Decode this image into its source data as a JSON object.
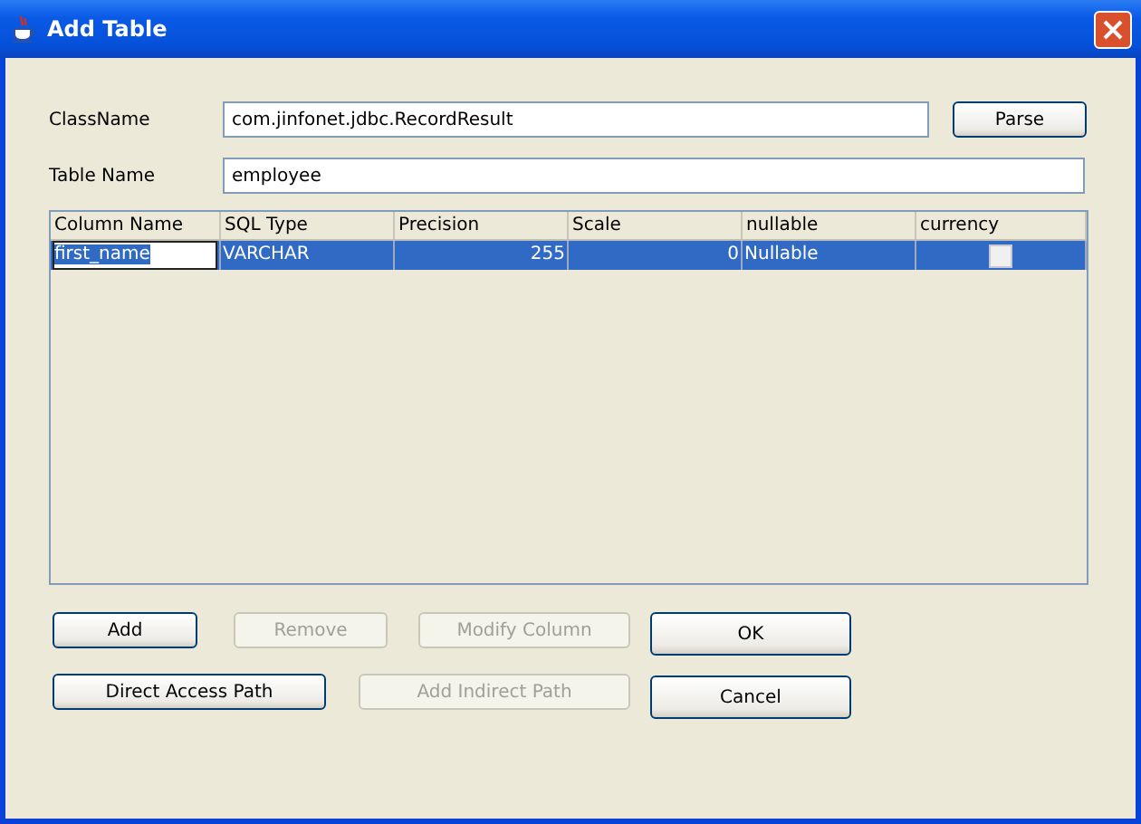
{
  "window": {
    "title": "Add Table"
  },
  "fields": [
    {
      "label": "ClassName",
      "value": "com.jinfonet.jdbc.RecordResult",
      "button": {
        "label": "Parse",
        "disabled": false
      }
    },
    {
      "label": "Table Name",
      "value": "employee"
    }
  ],
  "table": {
    "columns": [
      "Column Name",
      "SQL Type",
      "Precision",
      "Scale",
      "nullable",
      "currency"
    ],
    "rows": [
      {
        "selected": true,
        "cells": [
          {
            "kind": "text",
            "text": "first_name",
            "editing": true
          },
          {
            "kind": "text",
            "text": "VARCHAR",
            "editing": false
          },
          {
            "kind": "number",
            "text": "255",
            "editing": false
          },
          {
            "kind": "number",
            "text": "0",
            "editing": false
          },
          {
            "kind": "text",
            "text": "Nullable",
            "editing": false
          },
          {
            "kind": "checkbox",
            "checked": false
          }
        ]
      }
    ]
  },
  "buttons": [
    [
      {
        "label": "Add",
        "disabled": false
      },
      {
        "label": "Remove",
        "disabled": true
      },
      {
        "label": "Modify Column",
        "disabled": true
      }
    ],
    [
      {
        "label": "Direct Access Path",
        "disabled": false
      },
      {
        "label": "Add Indirect Path",
        "disabled": true
      }
    ]
  ],
  "dialog_buttons": [
    {
      "label": "OK",
      "disabled": false
    },
    {
      "label": "Cancel",
      "disabled": false
    }
  ]
}
